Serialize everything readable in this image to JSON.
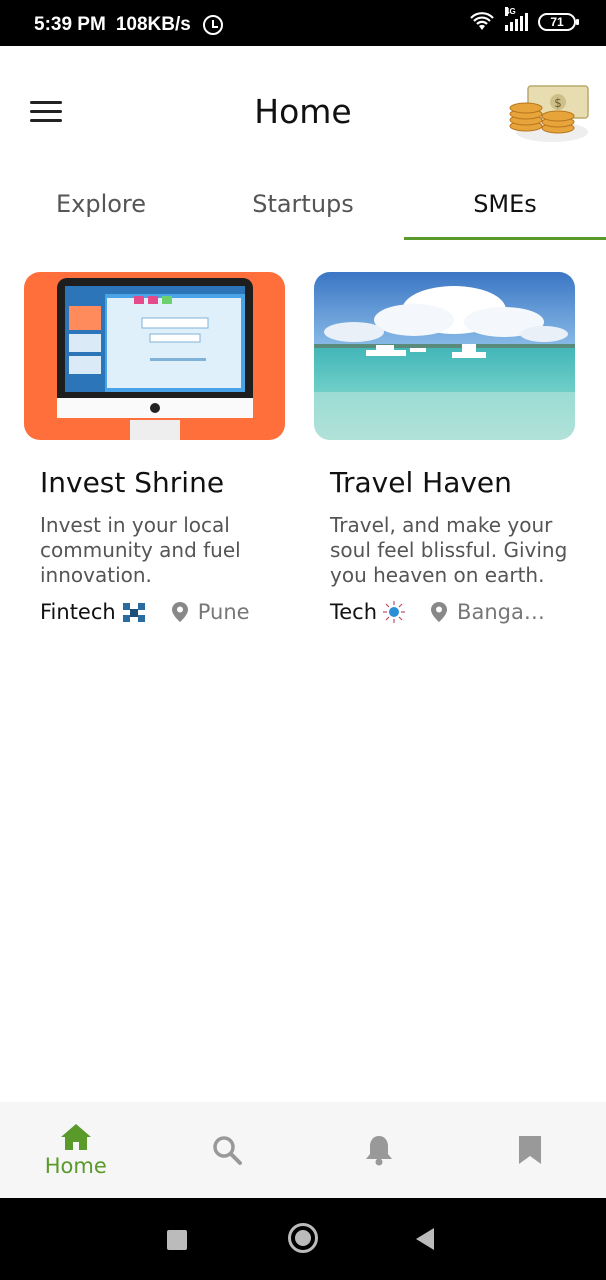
{
  "status_bar": {
    "time": "5:39 PM",
    "speed": "108KB/s",
    "network": "4G",
    "battery": "71"
  },
  "header": {
    "title": "Home",
    "menu_icon": "hamburger-menu-icon",
    "logo_icon": "coins-stack-icon"
  },
  "tabs": [
    {
      "label": "Explore",
      "active": false
    },
    {
      "label": "Startups",
      "active": false
    },
    {
      "label": "SMEs",
      "active": true
    }
  ],
  "accent_color": "#5a9a2a",
  "cards": [
    {
      "title": "Invest Shrine",
      "description": "Invest in your local community and fuel innovation.",
      "category": "Fintech",
      "category_icon": "blockchain-cubes-icon",
      "location": "Pune",
      "image": "computer-monitor-illustration",
      "image_bg": "#ff6f3c"
    },
    {
      "title": "Travel Haven",
      "description": "Travel, and make your soul feel blissful. Giving you heaven on earth.",
      "category": "Tech",
      "category_icon": "lightbulb-network-icon",
      "location": "Bangal...",
      "image": "tropical-sea-boats-photo"
    }
  ],
  "bottom_nav": [
    {
      "label": "Home",
      "icon": "home-icon",
      "active": true
    },
    {
      "label": "",
      "icon": "search-icon",
      "active": false
    },
    {
      "label": "",
      "icon": "bell-icon",
      "active": false
    },
    {
      "label": "",
      "icon": "bookmark-icon",
      "active": false
    }
  ]
}
